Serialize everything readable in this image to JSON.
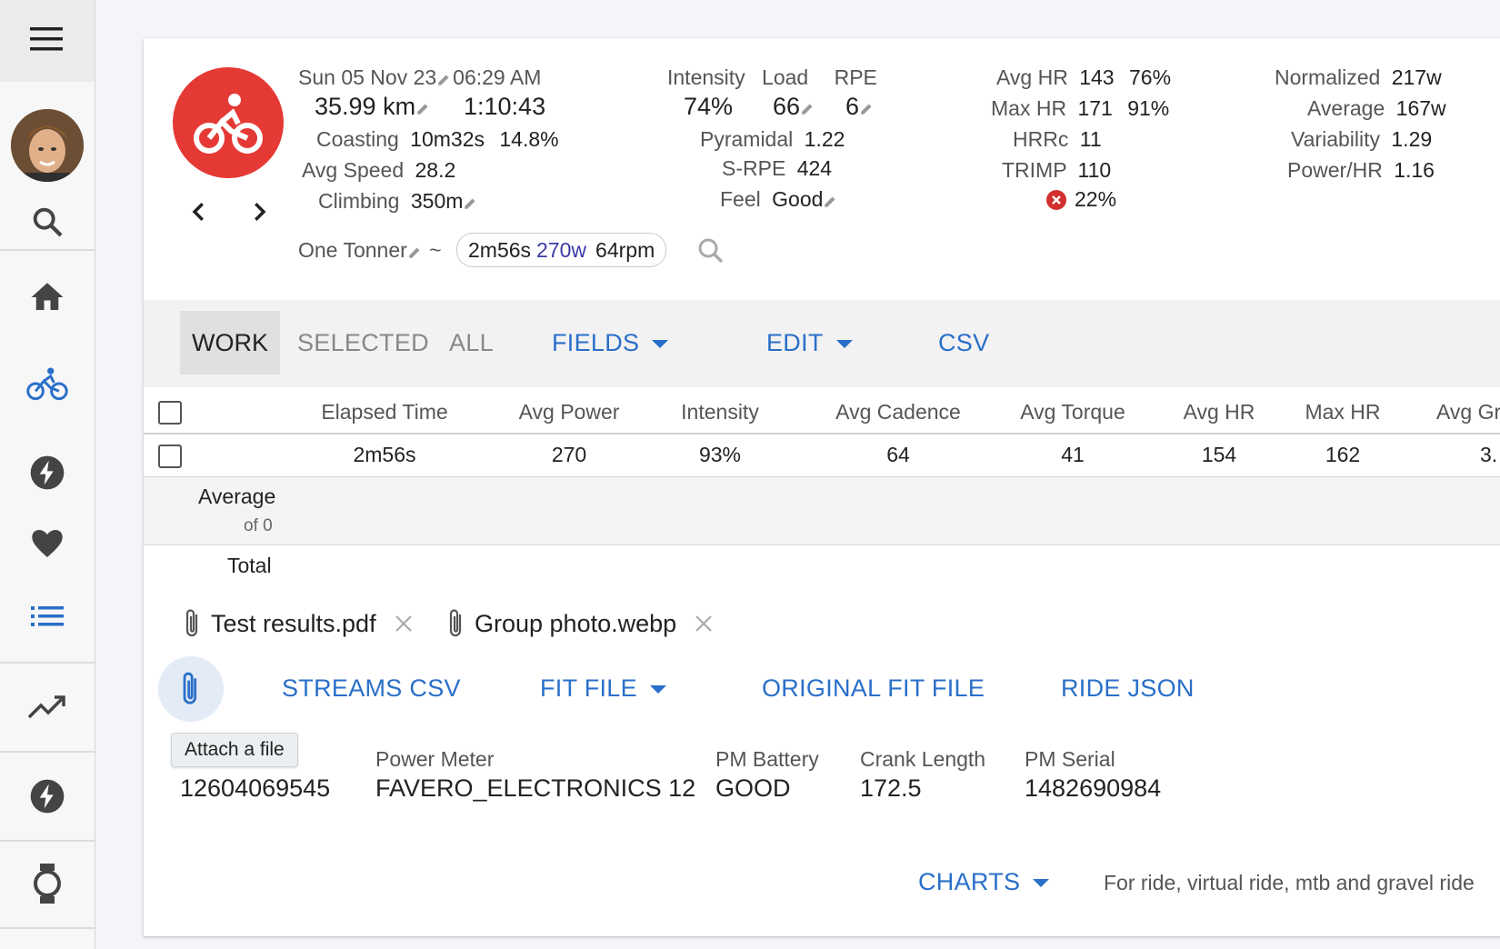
{
  "header": {
    "date": "Sun 05 Nov 23",
    "time": "06:29 AM",
    "distance": "35.99 km",
    "duration": "1:10:43",
    "coasting_label": "Coasting",
    "coasting_value": "10m32s",
    "coasting_pct": "14.8%",
    "avg_speed_label": "Avg Speed",
    "avg_speed_value": "28.2",
    "climbing_label": "Climbing",
    "climbing_value": "350m",
    "route_name": "One Tonner",
    "tilde": "~",
    "effort": {
      "time": "2m56s",
      "power": "270w",
      "cadence": "64rpm"
    }
  },
  "stats_mid": {
    "intensity_label": "Intensity",
    "load_label": "Load",
    "rpe_label": "RPE",
    "intensity_value": "74%",
    "load_value": "66",
    "rpe_value": "6",
    "pyramidal_label": "Pyramidal",
    "pyramidal_value": "1.22",
    "srpe_label": "S-RPE",
    "srpe_value": "424",
    "feel_label": "Feel",
    "feel_value": "Good"
  },
  "stats_hr": {
    "avg_hr_label": "Avg HR",
    "avg_hr_value": "143",
    "avg_hr_pct": "76%",
    "max_hr_label": "Max HR",
    "max_hr_value": "171",
    "max_hr_pct": "91%",
    "hrrc_label": "HRRc",
    "hrrc_value": "11",
    "trimp_label": "TRIMP",
    "trimp_value": "110",
    "decoupling_value": "22%"
  },
  "stats_power": {
    "normalized_label": "Normalized",
    "normalized_value": "217w",
    "average_label": "Average",
    "average_value": "167w",
    "variability_label": "Variability",
    "variability_value": "1.29",
    "power_hr_label": "Power/HR",
    "power_hr_value": "1.16"
  },
  "toolbar": {
    "work": "WORK",
    "selected": "SELECTED",
    "all": "ALL",
    "fields": "FIELDS",
    "edit": "EDIT",
    "csv": "CSV"
  },
  "table": {
    "columns": [
      "Elapsed Time",
      "Avg Power",
      "Intensity",
      "Avg Cadence",
      "Avg Torque",
      "Avg HR",
      "Max HR",
      "Avg Gr"
    ],
    "row": [
      "2m56s",
      "270",
      "93%",
      "64",
      "41",
      "154",
      "162",
      "3."
    ],
    "average_label": "Average",
    "average_sub": "of 0",
    "total_label": "Total"
  },
  "attachments": [
    {
      "name": "Test results.pdf"
    },
    {
      "name": "Group photo.webp"
    }
  ],
  "actions": {
    "streams_csv": "STREAMS CSV",
    "fit_file": "FIT FILE",
    "original_fit": "ORIGINAL FIT FILE",
    "ride_json": "RIDE JSON",
    "tooltip": "Attach a file"
  },
  "device": {
    "id_value": "12604069545",
    "power_meter_label": "Power Meter",
    "power_meter_value": "FAVERO_ELECTRONICS 12",
    "pm_battery_label": "PM Battery",
    "pm_battery_value": "GOOD",
    "crank_length_label": "Crank Length",
    "crank_length_value": "172.5",
    "pm_serial_label": "PM Serial",
    "pm_serial_value": "1482690984"
  },
  "footer": {
    "charts": "CHARTS",
    "note": "For ride, virtual ride, mtb and gravel ride"
  },
  "colors": {
    "accent": "#2a6fc9",
    "activity_red": "#e53935",
    "error_red": "#d32f2f"
  }
}
